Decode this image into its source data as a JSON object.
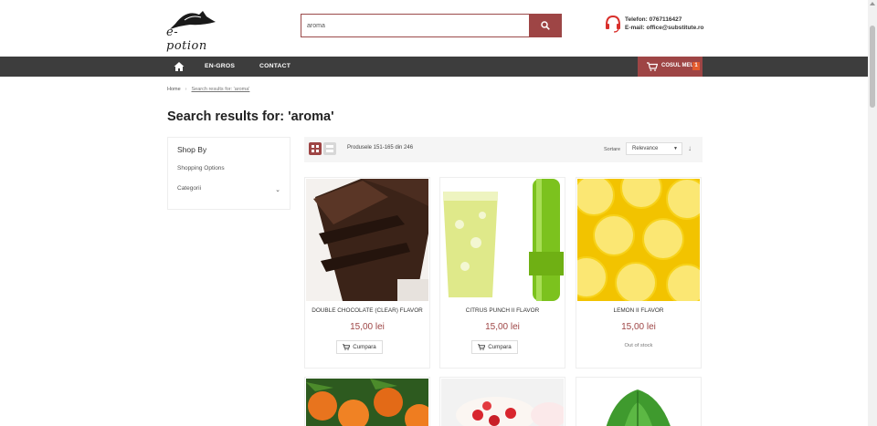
{
  "header": {
    "logo_text": "e-potion",
    "search": {
      "value": "aroma",
      "placeholder": ""
    },
    "contact": {
      "phone": "Telefon: 0767116427",
      "email": "E-mail: office@substitute.ro"
    }
  },
  "nav": {
    "items": [
      "EN-GROS",
      "CONTACT"
    ],
    "cart_label": "COSUL MEU",
    "cart_count": "1"
  },
  "breadcrumb": {
    "home": "Home",
    "current": "Search results for: 'aroma'"
  },
  "page_title": "Search results for: 'aroma'",
  "sidebar": {
    "heading": "Shop By",
    "options_label": "Shopping Options",
    "filter_label": "Categorii"
  },
  "toolbar": {
    "products_label": "Produsele 151-165 din 246",
    "sort_label": "Sortare",
    "sort_value": "Relevance"
  },
  "products": [
    {
      "name": "DOUBLE CHOCOLATE (CLEAR) FLAVOR",
      "price": "15,00 lei",
      "action": "Cumpara"
    },
    {
      "name": "CITRUS PUNCH II FLAVOR",
      "price": "15,00 lei",
      "action": "Cumpara"
    },
    {
      "name": "LEMON II FLAVOR",
      "price": "15,00 lei",
      "status": "Out of stock"
    }
  ],
  "colors": {
    "accent": "#9e4545",
    "nav_bg": "#3d3d3d",
    "cart_badge": "#e35b2d"
  },
  "icons": [
    "search-icon",
    "headset-icon",
    "home-icon",
    "cart-icon",
    "grid-view-icon",
    "list-view-icon",
    "chevron-down-icon",
    "sort-direction-icon"
  ]
}
